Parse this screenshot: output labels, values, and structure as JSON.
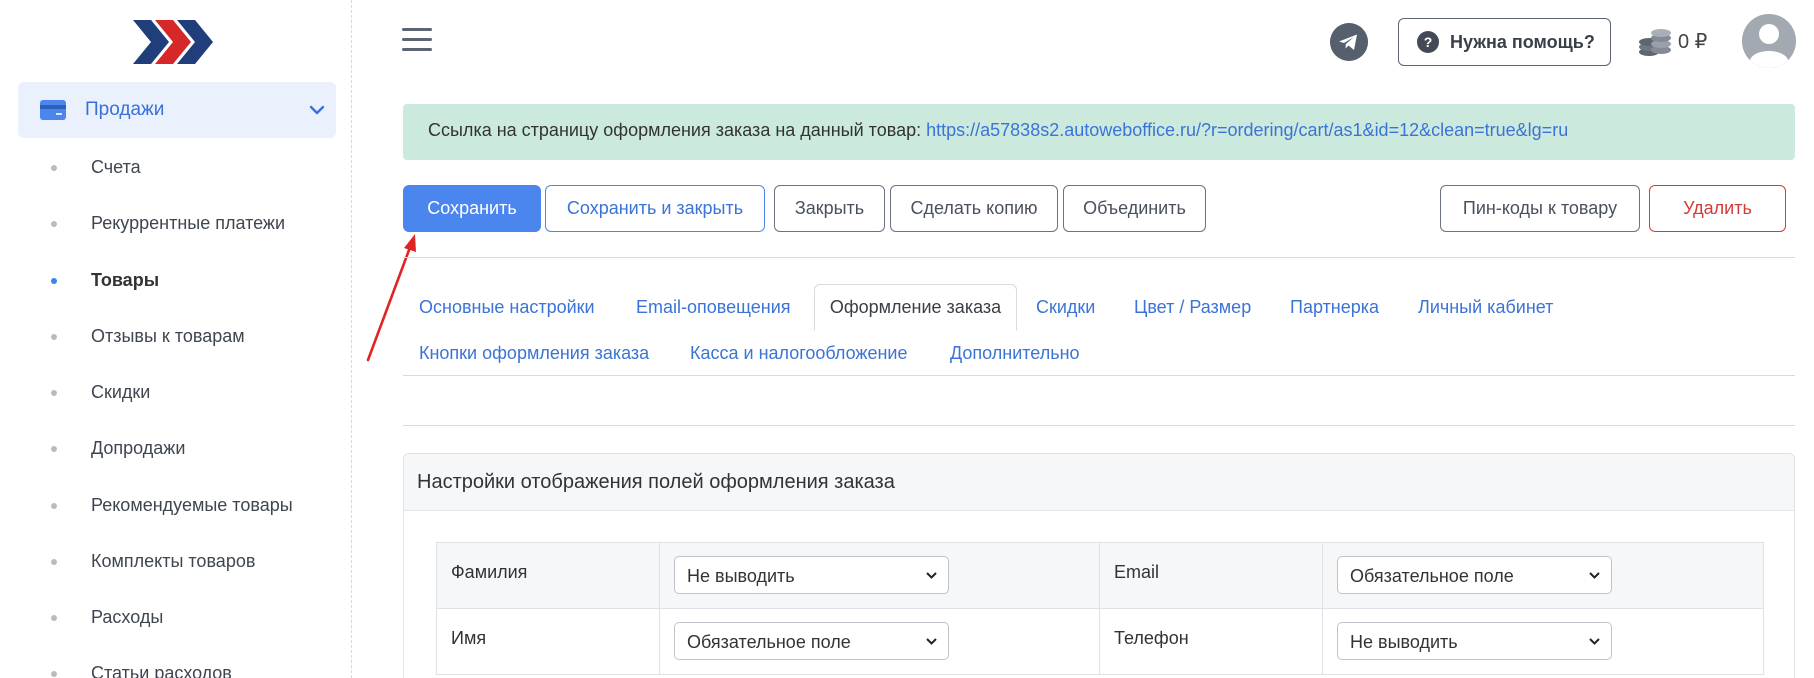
{
  "sidebar": {
    "logo_name": "chevrons-logo",
    "parent": {
      "label": "Продажи",
      "icon": "credit-card-icon"
    },
    "items": [
      {
        "label": "Счета"
      },
      {
        "label": "Рекуррентные платежи"
      },
      {
        "label": "Товары",
        "active": true
      },
      {
        "label": "Отзывы к товарам"
      },
      {
        "label": "Скидки"
      },
      {
        "label": "Допродажи"
      },
      {
        "label": "Рекомендуемые товары"
      },
      {
        "label": "Комплекты товаров"
      },
      {
        "label": "Расходы"
      },
      {
        "label": "Статьи расходов"
      }
    ]
  },
  "header": {
    "help_label": "Нужна помощь?",
    "help_icon": "?",
    "balance": "0 ₽"
  },
  "alert": {
    "text": "Ссылка на страницу оформления заказа на данный товар: ",
    "link": "https://a57838s2.autoweboffice.ru/?r=ordering/cart/as1&id=12&clean=true&lg=ru"
  },
  "toolbar": {
    "save": "Сохранить",
    "save_close": "Сохранить и закрыть",
    "close": "Закрыть",
    "copy": "Сделать копию",
    "merge": "Объединить",
    "pincodes": "Пин-коды к товару",
    "delete": "Удалить"
  },
  "tabs": {
    "row1": [
      "Основные настройки",
      "Email-оповещения",
      "Оформление заказа",
      "Скидки",
      "Цвет / Размер",
      "Партнерка",
      "Личный кабинет"
    ],
    "row2": [
      "Кнопки оформления заказа",
      "Касса и налогообложение",
      "Дополнительно"
    ],
    "active": "Оформление заказа"
  },
  "card": {
    "title": "Настройки отображения полей оформления заказа",
    "rows": [
      {
        "left_label": "Фамилия",
        "left_value": "Не выводить",
        "right_label": "Email",
        "right_value": "Обязательное поле"
      },
      {
        "left_label": "Имя",
        "left_value": "Обязательное поле",
        "right_label": "Телефон",
        "right_value": "Не выводить"
      }
    ]
  },
  "colors": {
    "primary": "#4b85ee",
    "danger": "#d33a3a",
    "alert_bg": "#cbeadd",
    "sidebar_active_bg": "#eaf1fd",
    "annotation_arrow": "#e02424"
  }
}
